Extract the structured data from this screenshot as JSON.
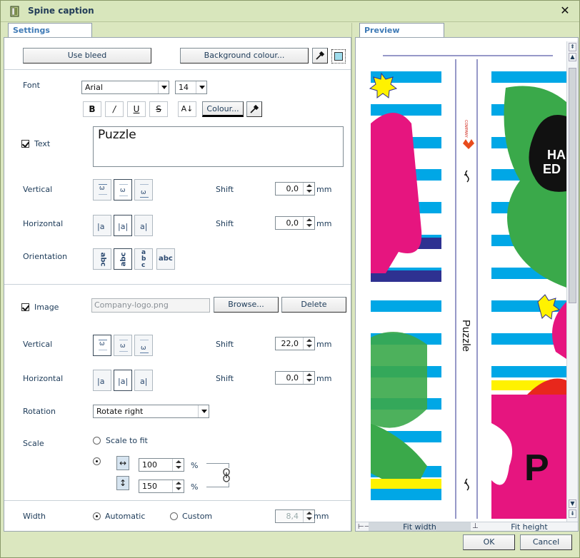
{
  "window": {
    "title": "Spine caption"
  },
  "tabs": {
    "settings": "Settings",
    "preview": "Preview"
  },
  "top": {
    "use_bleed": "Use bleed",
    "background_colour": "Background colour..."
  },
  "font": {
    "label": "Font",
    "family": "Arial",
    "size": "14",
    "bold": "B",
    "italic": "/",
    "underline": "U",
    "strike": "S",
    "case": "A↓",
    "colour": "Colour..."
  },
  "text": {
    "label": "Text",
    "checked": true,
    "value": "Puzzle",
    "vertical_label": "Vertical",
    "horizontal_label": "Horizontal",
    "orientation_label": "Orientation",
    "shift_label": "Shift",
    "vertical_shift": "0,0",
    "horizontal_shift": "0,0",
    "unit": "mm",
    "orientation_glyphs": [
      "abc",
      "abc",
      "abc",
      "abc"
    ]
  },
  "image": {
    "label": "Image",
    "checked": true,
    "file": "Company-logo.png",
    "browse": "Browse...",
    "delete": "Delete",
    "vertical_label": "Vertical",
    "horizontal_label": "Horizontal",
    "shift_label": "Shift",
    "vertical_shift": "22,0",
    "horizontal_shift": "0,0",
    "unit": "mm",
    "rotation_label": "Rotation",
    "rotation": "Rotate right",
    "scale_label": "Scale",
    "scale_to_fit": "Scale to fit",
    "scale_x": "100",
    "scale_y": "150",
    "percent": "%"
  },
  "width": {
    "label": "Width",
    "automatic": "Automatic",
    "custom": "Custom",
    "value": "8,4",
    "unit": "mm"
  },
  "preview": {
    "spine_text": "Puzzle",
    "logo_text": "COMPANY",
    "cover_text": "HA ED",
    "cover_letter": "P",
    "fit_width": "Fit width",
    "fit_height": "Fit height"
  },
  "footer": {
    "ok": "OK",
    "cancel": "Cancel"
  },
  "colors": {
    "accent": "#3e7ab6",
    "chrome": "#dbe7bf",
    "stripe_blue": "#00a7e6",
    "stripe_navy": "#2e3191",
    "magenta": "#e6157f",
    "green": "#3aa94a",
    "yellow": "#fff200"
  }
}
